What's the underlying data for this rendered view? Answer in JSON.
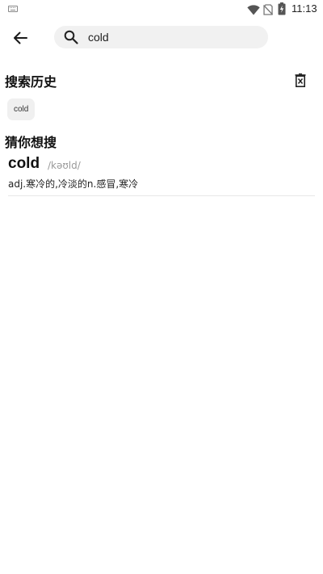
{
  "status_bar": {
    "time": "11:13",
    "icons": [
      "keyboard-icon",
      "wifi-icon",
      "no-sim-icon",
      "battery-charging-icon"
    ]
  },
  "header": {
    "back_icon": "arrow-left-icon",
    "search": {
      "icon": "search-icon",
      "value": "cold"
    }
  },
  "history": {
    "title": "搜索历史",
    "delete_icon": "trash-icon",
    "items": [
      "cold"
    ]
  },
  "suggestions": {
    "title": "猜你想搜",
    "items": [
      {
        "word": "cold",
        "phonetic": "/kəʊld/",
        "definition": "adj.寒冷的,冷淡的n.感冒,寒冷"
      }
    ]
  },
  "colors": {
    "search_bg": "#f1f1f1",
    "chip_bg": "#f0f0f0",
    "divider": "#e8e8e8",
    "phonetic": "#999999"
  }
}
